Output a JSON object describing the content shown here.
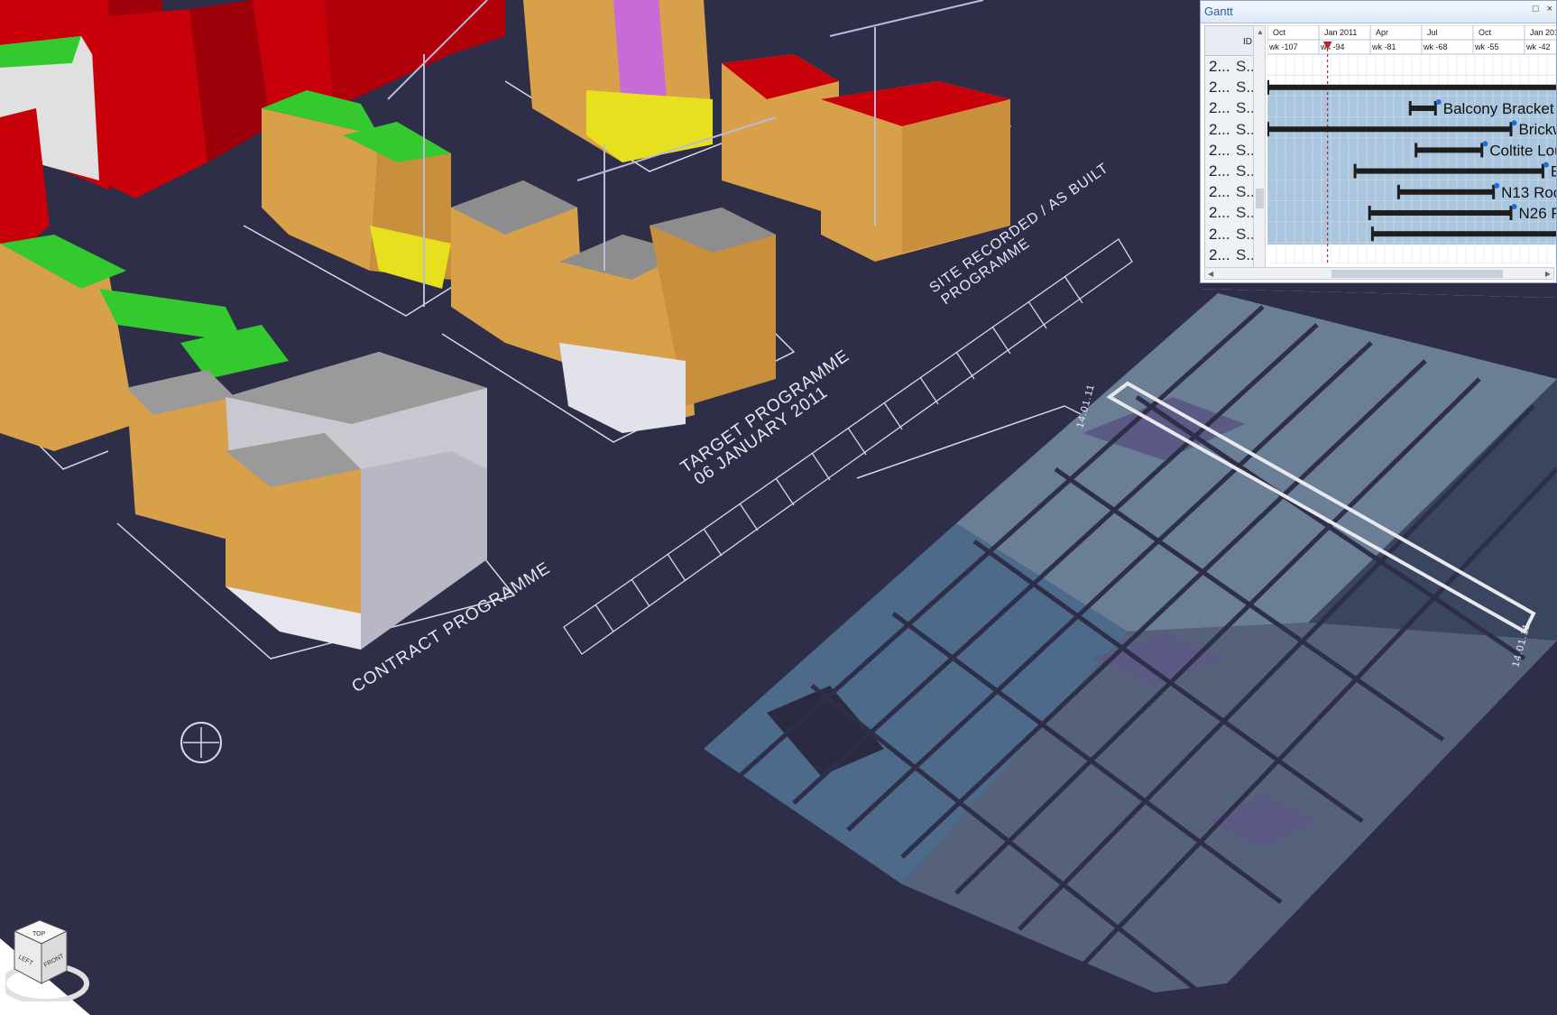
{
  "scene": {
    "labels": {
      "contract": "CONTRACT PROGRAMME",
      "target_line1": "TARGET PROGRAMME",
      "target_line2": "06 JANUARY 2011",
      "site_line1": "SITE RECORDED / AS BUILT",
      "site_line2": "PROGRAMME",
      "date_top": "14.01.11",
      "date_right": "14.01.11"
    },
    "colors": {
      "floor": "#2e2e48",
      "building_red": "#c8000a",
      "roof_green": "#34c92e",
      "facade_orange": "#d9a04a",
      "roof_grey": "#8d8d8d"
    }
  },
  "gantt": {
    "title": "Gantt",
    "window_buttons": [
      "□",
      "×"
    ],
    "id_header": "ID",
    "timeline": {
      "months": [
        "Oct",
        "Jan 2011",
        "Apr",
        "Jul",
        "Oct",
        "Jan 2012"
      ],
      "weeks": [
        "wk -107",
        "wk -94",
        "wk -81",
        "wk -68",
        "wk -55",
        "wk -42"
      ]
    },
    "rows": [
      {
        "c1": "2...",
        "c2": "S...",
        "label": "",
        "start": null,
        "end": null
      },
      {
        "c1": "2...",
        "c2": "S...",
        "label": "",
        "start": 0.0,
        "end": 1.0
      },
      {
        "c1": "2...",
        "c2": "S...",
        "label": "Balcony Bracket",
        "start": 0.49,
        "end": 0.58
      },
      {
        "c1": "2...",
        "c2": "S...",
        "label": "Brickw",
        "start": 0.0,
        "end": 0.84
      },
      {
        "c1": "2...",
        "c2": "S...",
        "label": "Coltite Lou",
        "start": 0.51,
        "end": 0.74
      },
      {
        "c1": "2...",
        "c2": "S...",
        "label": "Er",
        "start": 0.3,
        "end": 0.95
      },
      {
        "c1": "2...",
        "c2": "S...",
        "label": "N13 Roo",
        "start": 0.45,
        "end": 0.78
      },
      {
        "c1": "2...",
        "c2": "S...",
        "label": "N26 R",
        "start": 0.35,
        "end": 0.84
      },
      {
        "c1": "2...",
        "c2": "S...",
        "label": "",
        "start": 0.36,
        "end": 1.0
      },
      {
        "c1": "2...",
        "c2": "S...",
        "label": "",
        "start": null,
        "end": null
      }
    ]
  },
  "viewcube": {
    "faces": [
      "TOP",
      "LEFT",
      "FRONT"
    ]
  }
}
